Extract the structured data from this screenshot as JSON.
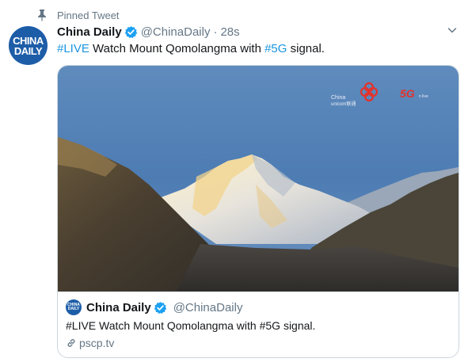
{
  "pinned": {
    "label": "Pinned Tweet",
    "icon": "pin-icon"
  },
  "author": {
    "display_name": "China Daily",
    "handle": "@ChinaDaily",
    "separator": "·",
    "time": "28s",
    "avatar_text_line1": "CHINA",
    "avatar_text_line2": "DAILY",
    "verified": true
  },
  "tweet": {
    "hashtag1": "#LIVE",
    "text1": " Watch Mount Qomolangma with ",
    "hashtag2": "#5G",
    "text2": " signal."
  },
  "card": {
    "image_overlay": {
      "brand_line1": "China",
      "brand_line2": "unicom联通",
      "badge": "5G",
      "badge_suffix": "n live"
    },
    "author_name": "China Daily",
    "author_handle": "@ChinaDaily",
    "description": "#LIVE Watch Mount Qomolangma with #5G signal.",
    "domain": "pscp.tv"
  },
  "colors": {
    "link": "#1b95e0",
    "secondary_text": "#657786",
    "border": "#ccd6dd",
    "avatar_bg": "#1d5da8",
    "verified": "#1da1f2"
  }
}
